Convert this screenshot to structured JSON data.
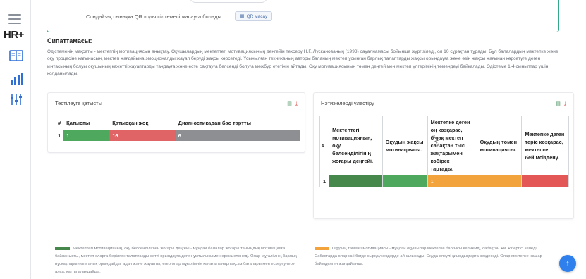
{
  "app": {
    "logo": "HR+"
  },
  "sidebar": {
    "icons": [
      "menu-icon",
      "book-icon",
      "bar-chart-icon",
      "sliders-icon"
    ]
  },
  "qr": {
    "text": "Сондай-ақ сынаққа QR коды сілтемесі жасауға болады",
    "button_label": "QR масау"
  },
  "description": {
    "title": "Сипаттамасы:",
    "text": "Әдістеменің мақсаты - мектептің мотивациясын анықтау. Оқушылардың мектептегі мотивациясының деңгейін тексеру Н.Г. Лусканованың (1993) сауалнамасы бойынша жүргізіледі, ол 10 сұрақтан тұрады. Бұл балалардың мектепке және оқу процесіне қатынасын, мектеп жағдайына эмоционалды жауап беруді жақсы көрсетеді. Ұсынылған техниканың авторы баланың мектеп ұсынған барлық талаптарды жақсы орындауға және өзін жақсы жағынан көрсетуге деген ынтасының болуы оқушының қажетті жауаптарды таңдауға және есте сақтауға белсенді болуға мәжбүр ететінін айтады. Оқу мотивациясының төмен деңгейімен мектеп үлгерімінің төмендеуі байқалады. Әдістеме 1-4 сыныптар үшін қолданылады."
  },
  "participation": {
    "title": "Тестілеуге қатысты",
    "headers": [
      "#",
      "Қатысты",
      "Қатысқан жоқ",
      "Диагностикадан бас тартты"
    ],
    "row": {
      "index": "1",
      "participated": "1",
      "not_participated": "16",
      "refused": "6"
    },
    "colors": {
      "participated": "#4ea85e",
      "not_participated": "#e06466",
      "refused": "#8d8f92"
    }
  },
  "distribution": {
    "title": "Нәтижелерді үлестіру",
    "headers": [
      "#",
      "Мектептегі мотивацияның, оқу белсенділігінің жоғары деңгейі.",
      "Оқудың жақсы мотивациясы.",
      "Мектепке деген оң көзқарас, бірақ мектеп сабақтан тыс жақтарымен көбірек тартады.",
      "Оқудың төмен мотивациясы.",
      "Мектепке деген теріс көзқарас, мектепке бейімсіздену."
    ],
    "row": {
      "index": "1",
      "c1": "",
      "c2": "",
      "c3": "1",
      "c4": "",
      "c5": ""
    },
    "colors": {
      "c1": "#46884c",
      "c2": "#4ea85e",
      "c3": "#f3a33b",
      "c4": "#f3a33b",
      "c5": "#e35856"
    }
  },
  "legend": {
    "left": {
      "color": "#46884c",
      "text": "Мектептегі мотивацияның, оқу белсенділігінің жоғары деңгейі - мұндай балалар жоғары танымдық мотивацияға байланысты, мектеп оларға берілген талаптарды сәтті орындауға деген ұмтылысымен ерекшеленеді. Олар мұғалімнің барлық нұсқауларын өте анық орындайды, адал және жауапты, егер олар мұғалімнің қанағаттанарлықсыз бағалары мен ескертулерін алса, қатты алаңдайды."
    },
    "right": {
      "color": "#f3a33b",
      "text": "Оқудың төменгі мотивациясы - мұндай оқушылар мектепке барғысы келмейді, сабақтан жиі жібергісі келеді. Сабақтарда олар жиі бөгде сырқау кездерде айналысады. Оқуда елеулі қиындықтарға кездеседі. Олар мектепке нашар бейімделген жағдайында."
    }
  }
}
